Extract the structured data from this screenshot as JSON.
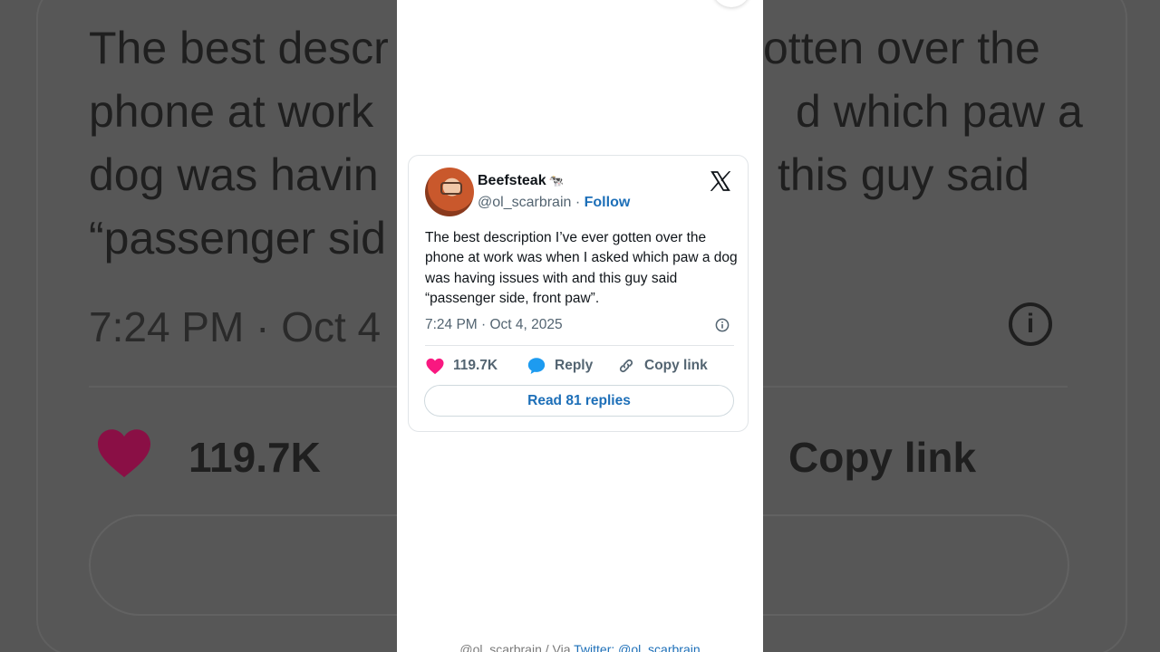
{
  "background": {
    "text_lines": [
      "The best descr",
      "phone at work",
      "dog was havin",
      "“passenger sid"
    ],
    "text_right_lines": [
      "otten over the",
      "d which paw a",
      "this guy said"
    ],
    "time": "7:24 PM · Oct 4",
    "likes": "119.7K",
    "copy_link": "Copy link"
  },
  "tweet": {
    "display_name": "Beefsteak",
    "name_emoji": "🐄",
    "handle": "@ol_scarbrain",
    "separator": " · ",
    "follow_label": "Follow",
    "text": "The best description I’ve ever gotten over the phone at work was when I asked which paw a dog was having issues with and this guy said “passenger side, front paw”.",
    "timestamp": "7:24 PM · Oct 4, 2025",
    "likes": "119.7K",
    "reply_label": "Reply",
    "copy_link_label": "Copy link",
    "read_replies_label": "Read 81 replies",
    "icons": {
      "platform": "x-logo-icon",
      "info": "info-icon",
      "like": "heart-icon",
      "reply": "speech-bubble-icon",
      "copy": "link-icon"
    },
    "colors": {
      "heart": "#f91880",
      "reply_bubble": "#1d9bf0",
      "link_blue": "#1d6fb8"
    }
  },
  "credit": {
    "prefix": "@ol_scarbrain / Via ",
    "link_text": "Twitter: @ol_scarbrain"
  }
}
